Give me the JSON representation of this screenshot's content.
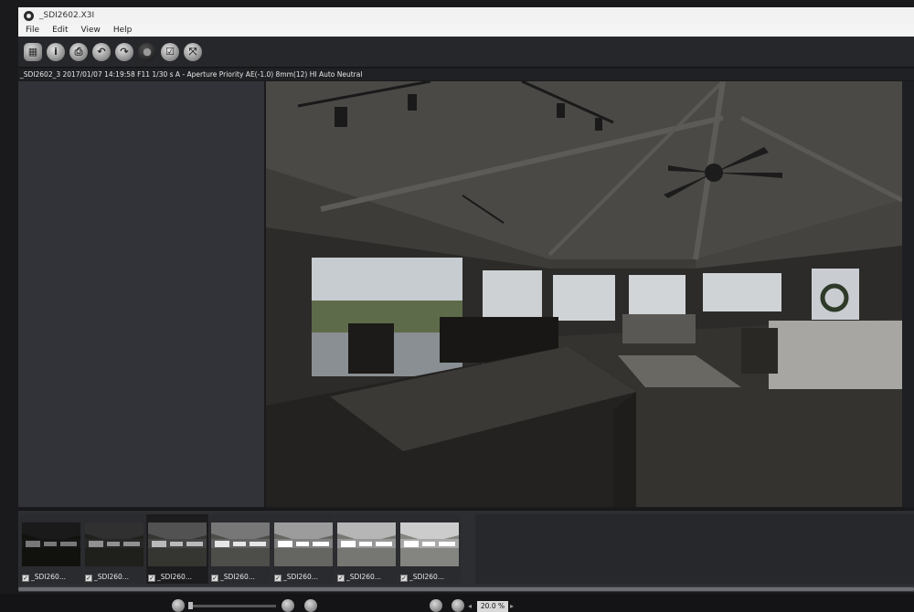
{
  "window": {
    "title": "_SDI2602.X3I"
  },
  "menu": [
    "File",
    "Edit",
    "View",
    "Help"
  ],
  "toolbar": {
    "buttons": [
      {
        "icon": "grid-view-icon",
        "glyph": "▦"
      },
      {
        "icon": "info-icon",
        "glyph": "i"
      },
      {
        "icon": "print-icon",
        "glyph": "⎙"
      },
      {
        "icon": "rotate-left-icon",
        "glyph": "↶"
      },
      {
        "icon": "rotate-right-icon",
        "glyph": "↷"
      },
      {
        "icon": "color-wheel-icon",
        "glyph": "●"
      },
      {
        "icon": "checkbox-icon",
        "glyph": "☑"
      },
      {
        "icon": "fit-screen-icon",
        "glyph": "⤧"
      }
    ]
  },
  "info": {
    "exif": "_SDI2602_3 2017/01/07 14:19:58 F11 1/30 s A - Aperture Priority AE(-1.0) 8mm(12) HI Auto Neutral"
  },
  "filmstrip": {
    "thumbnails": [
      {
        "label": "_SDI260...",
        "checked": true,
        "brightness": 0.12
      },
      {
        "label": "_SDI260...",
        "checked": true,
        "brightness": 0.22
      },
      {
        "label": "_SDI260...",
        "checked": true,
        "brightness": 0.38
      },
      {
        "label": "_SDI260...",
        "checked": true,
        "brightness": 0.55
      },
      {
        "label": "_SDI260...",
        "checked": true,
        "brightness": 0.72
      },
      {
        "label": "_SDI260...",
        "checked": true,
        "brightness": 0.84
      },
      {
        "label": "_SDI260...",
        "checked": true,
        "brightness": 0.94
      }
    ],
    "selected_index": 2
  },
  "zoom": {
    "value": "20.0 %"
  }
}
